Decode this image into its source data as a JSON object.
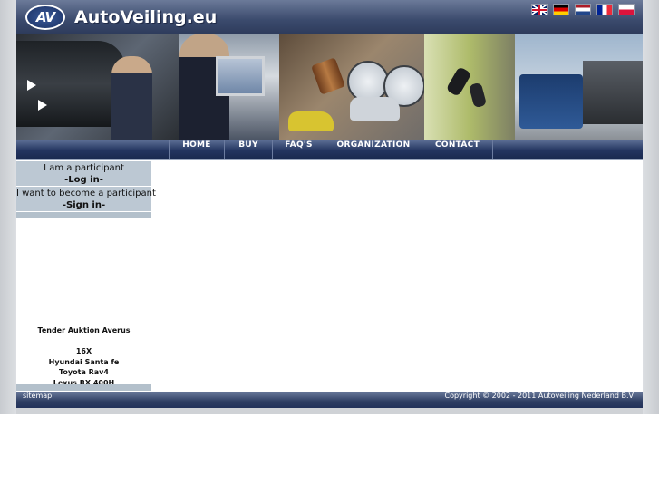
{
  "header": {
    "logo_mark": "AV",
    "logo_text": "AutoVeiling.eu",
    "flags": [
      {
        "name": "english-flag-icon",
        "cls": "flag-en"
      },
      {
        "name": "german-flag-icon",
        "cls": "flag-de"
      },
      {
        "name": "dutch-flag-icon",
        "cls": "flag-nl"
      },
      {
        "name": "french-flag-icon",
        "cls": "flag-fr"
      },
      {
        "name": "polish-flag-icon",
        "cls": "flag-pl"
      }
    ]
  },
  "nav": {
    "items": [
      {
        "label": "HOME"
      },
      {
        "label": "BUY"
      },
      {
        "label": "FAQ'S"
      },
      {
        "label": "ORGANIZATION"
      },
      {
        "label": "CONTACT"
      }
    ]
  },
  "sidebar": {
    "login_line1": "I am a participant",
    "login_line2": "-Log in-",
    "signin_line1": "I want to become a participant",
    "signin_line2": "-Sign in-",
    "tender_lines": [
      "Tender Auktion Averus",
      "",
      "16X",
      "Hyundai  Santa fe",
      "Toyota Rav4",
      "Lexus RX 400H"
    ]
  },
  "footer": {
    "sitemap": "sitemap",
    "copyright": "Copyright © 2002 - 2011 Autoveiling Nederland B.V"
  }
}
